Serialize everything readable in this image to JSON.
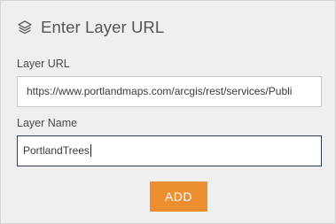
{
  "dialog": {
    "title": "Enter Layer URL",
    "header_icon": "layers-icon"
  },
  "layer_url": {
    "label": "Layer URL",
    "value": "https://www.portlandmaps.com/arcgis/rest/services/Publi"
  },
  "layer_name": {
    "label": "Layer Name",
    "value": "PortlandTrees"
  },
  "actions": {
    "add_label": "ADD"
  },
  "colors": {
    "panel_background": "#efefef",
    "add_button": "#ec8f31",
    "focused_border": "#2b3e5c"
  }
}
